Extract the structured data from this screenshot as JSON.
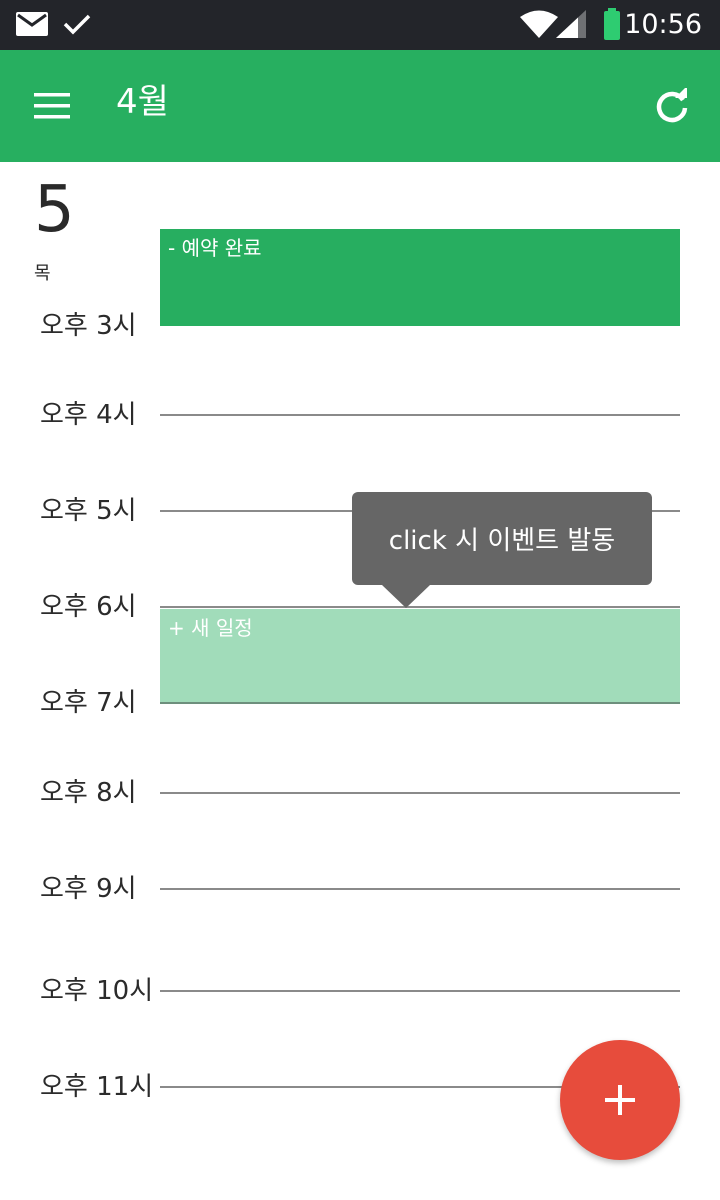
{
  "status_bar": {
    "time": "10:56",
    "icons": [
      "mail-icon",
      "check-icon",
      "wifi-icon",
      "signal-icon",
      "battery-icon"
    ]
  },
  "app_bar": {
    "title": "4월",
    "menu_icon": "hamburger-menu-icon",
    "refresh_icon": "refresh-icon",
    "color": "#27af60"
  },
  "day": {
    "number": "5",
    "weekday": "목"
  },
  "time_slots": [
    "오후 3시",
    "오후 4시",
    "오후 5시",
    "오후 6시",
    "오후 7시",
    "오후 8시",
    "오후 9시",
    "오후 10시",
    "오후 11시"
  ],
  "events": [
    {
      "label": "- 예약 완료",
      "color": "#27ae60"
    },
    {
      "label": "+ 새 일정",
      "color": "#a1dcba"
    }
  ],
  "tooltip": {
    "text": "click 시 이벤트 발동"
  },
  "fab": {
    "icon": "plus-icon",
    "color": "#e74c3c"
  }
}
